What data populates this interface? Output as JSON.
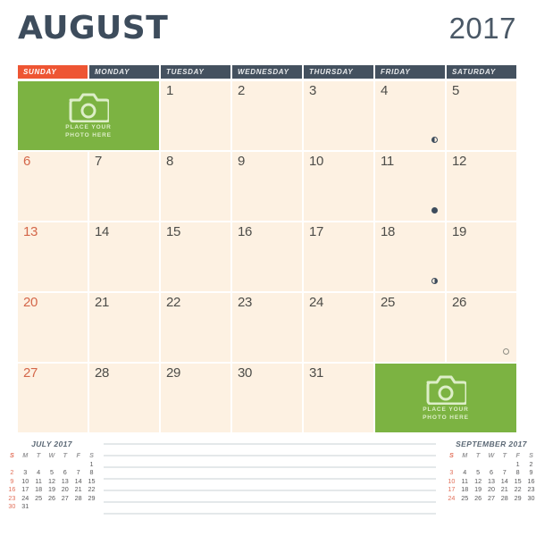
{
  "header": {
    "month": "AUGUST",
    "year": "2017",
    "accent_sunday": "#ee5533",
    "accent_header": "#44515f",
    "accent_photo": "#7cb342",
    "cell_bg": "#fdf1e2"
  },
  "weekdays": [
    {
      "label": "SUNDAY",
      "is_sunday": true
    },
    {
      "label": "MONDAY",
      "is_sunday": false
    },
    {
      "label": "TUESDAY",
      "is_sunday": false
    },
    {
      "label": "WEDNESDAY",
      "is_sunday": false
    },
    {
      "label": "THURSDAY",
      "is_sunday": false
    },
    {
      "label": "FRIDAY",
      "is_sunday": false
    },
    {
      "label": "SATURDAY",
      "is_sunday": false
    }
  ],
  "photo_placeholder": {
    "line1": "PLACE YOUR",
    "line2": "PHOTO HERE",
    "text": "PLACE YOUR\nPHOTO HERE",
    "icon": "camera-icon"
  },
  "days": [
    {
      "n": "",
      "sun": false,
      "moon": "",
      "photo": true
    },
    {
      "n": "1",
      "sun": false,
      "moon": ""
    },
    {
      "n": "2",
      "sun": false,
      "moon": ""
    },
    {
      "n": "3",
      "sun": false,
      "moon": ""
    },
    {
      "n": "4",
      "sun": false,
      "moon": "last"
    },
    {
      "n": "5",
      "sun": false,
      "moon": ""
    },
    {
      "n": "6",
      "sun": true,
      "moon": ""
    },
    {
      "n": "7",
      "sun": false,
      "moon": ""
    },
    {
      "n": "8",
      "sun": false,
      "moon": ""
    },
    {
      "n": "9",
      "sun": false,
      "moon": ""
    },
    {
      "n": "10",
      "sun": false,
      "moon": ""
    },
    {
      "n": "11",
      "sun": false,
      "moon": "new"
    },
    {
      "n": "12",
      "sun": false,
      "moon": ""
    },
    {
      "n": "13",
      "sun": true,
      "moon": ""
    },
    {
      "n": "14",
      "sun": false,
      "moon": ""
    },
    {
      "n": "15",
      "sun": false,
      "moon": ""
    },
    {
      "n": "16",
      "sun": false,
      "moon": ""
    },
    {
      "n": "17",
      "sun": false,
      "moon": ""
    },
    {
      "n": "18",
      "sun": false,
      "moon": "first"
    },
    {
      "n": "19",
      "sun": false,
      "moon": ""
    },
    {
      "n": "20",
      "sun": true,
      "moon": ""
    },
    {
      "n": "21",
      "sun": false,
      "moon": ""
    },
    {
      "n": "22",
      "sun": false,
      "moon": ""
    },
    {
      "n": "23",
      "sun": false,
      "moon": ""
    },
    {
      "n": "24",
      "sun": false,
      "moon": ""
    },
    {
      "n": "25",
      "sun": false,
      "moon": ""
    },
    {
      "n": "26",
      "sun": false,
      "moon": "full"
    },
    {
      "n": "27",
      "sun": true,
      "moon": ""
    },
    {
      "n": "28",
      "sun": false,
      "moon": ""
    },
    {
      "n": "29",
      "sun": false,
      "moon": ""
    },
    {
      "n": "30",
      "sun": false,
      "moon": ""
    },
    {
      "n": "31",
      "sun": false,
      "moon": ""
    }
  ],
  "mini_calendars": {
    "previous": {
      "title": "JULY 2017",
      "weekday_initials": [
        "S",
        "M",
        "T",
        "W",
        "T",
        "F",
        "S"
      ],
      "weeks": [
        [
          "",
          "",
          "",
          "",
          "",
          "",
          "1"
        ],
        [
          "2",
          "3",
          "4",
          "5",
          "6",
          "7",
          "8"
        ],
        [
          "9",
          "10",
          "11",
          "12",
          "13",
          "14",
          "15"
        ],
        [
          "16",
          "17",
          "18",
          "19",
          "20",
          "21",
          "22"
        ],
        [
          "23",
          "24",
          "25",
          "26",
          "27",
          "28",
          "29"
        ],
        [
          "30",
          "31",
          "",
          "",
          "",
          "",
          ""
        ]
      ]
    },
    "next": {
      "title": "SEPTEMBER 2017",
      "weekday_initials": [
        "S",
        "M",
        "T",
        "W",
        "T",
        "F",
        "S"
      ],
      "weeks": [
        [
          "",
          "",
          "",
          "",
          "",
          "1",
          "2"
        ],
        [
          "3",
          "4",
          "5",
          "6",
          "7",
          "8",
          "9"
        ],
        [
          "10",
          "11",
          "12",
          "13",
          "14",
          "15",
          "16"
        ],
        [
          "17",
          "18",
          "19",
          "20",
          "21",
          "22",
          "23"
        ],
        [
          "24",
          "25",
          "26",
          "27",
          "28",
          "29",
          "30"
        ]
      ]
    }
  },
  "notes": {
    "line_count": 7
  }
}
